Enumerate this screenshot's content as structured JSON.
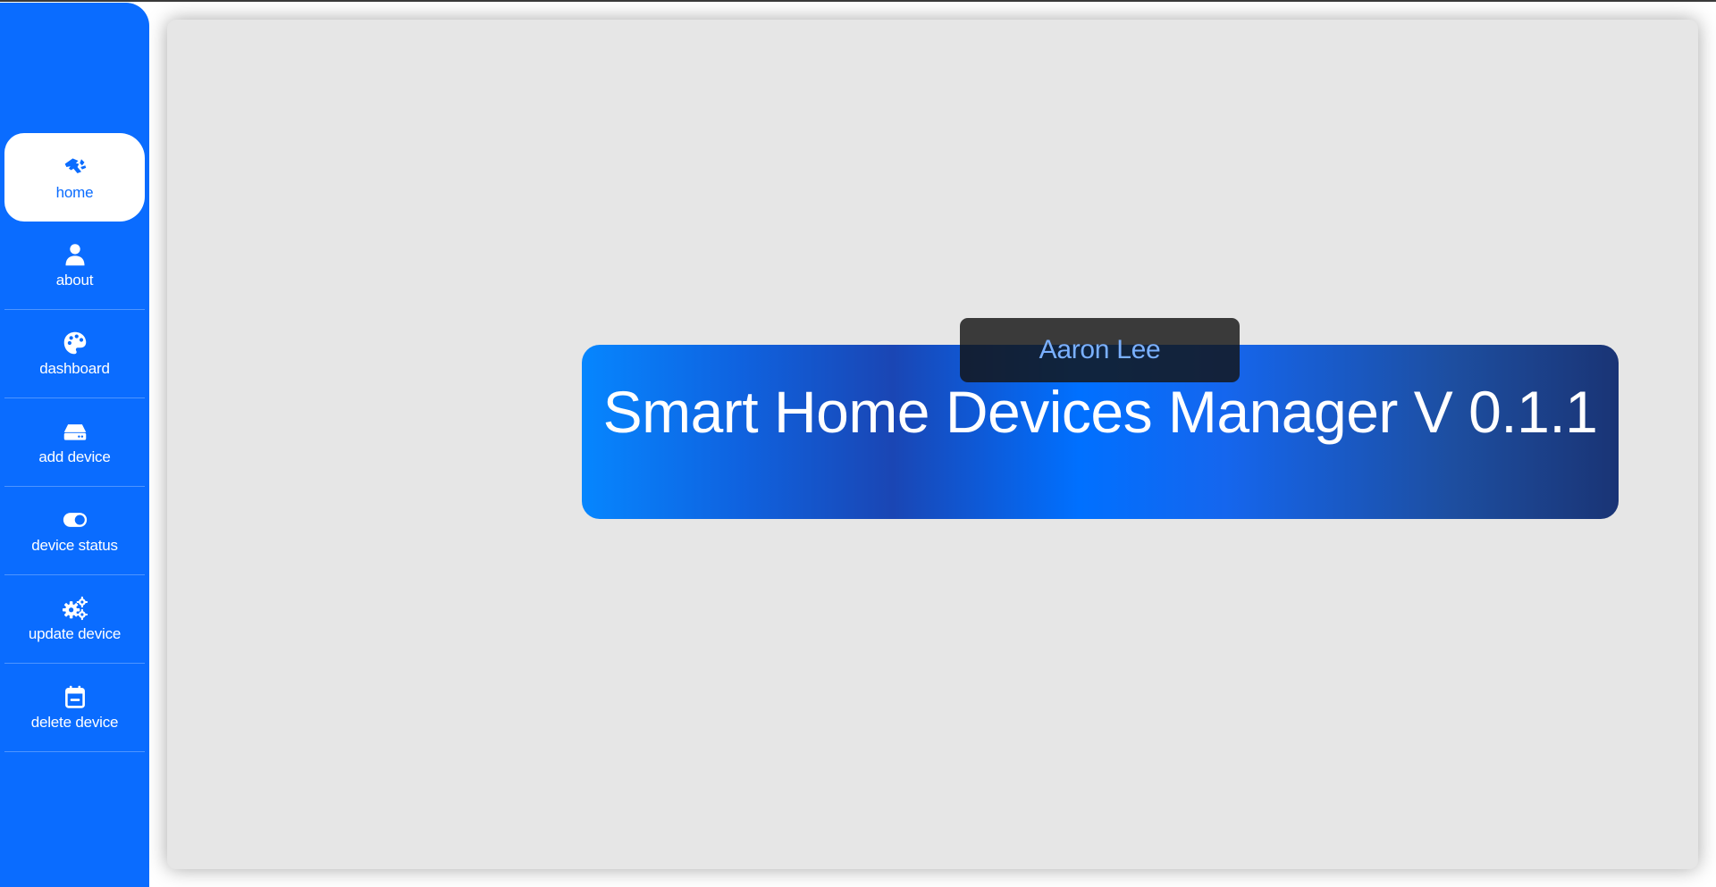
{
  "app": {
    "title": "Smart Home Devices Manager V 0.1.1",
    "author": "Aaron Lee"
  },
  "sidebar": {
    "items": [
      {
        "label": "home",
        "icon": "hand-icon",
        "active": true
      },
      {
        "label": "about",
        "icon": "user-icon",
        "active": false
      },
      {
        "label": "dashboard",
        "icon": "palette-icon",
        "active": false
      },
      {
        "label": "add device",
        "icon": "hard-drive-icon",
        "active": false
      },
      {
        "label": "device status",
        "icon": "toggle-icon",
        "active": false
      },
      {
        "label": "update device",
        "icon": "gears-icon",
        "active": false
      },
      {
        "label": "delete device",
        "icon": "calendar-minus-icon",
        "active": false
      }
    ]
  },
  "colors": {
    "primary": "#0a6cff",
    "content_background": "#e6e6e6",
    "author_text": "#7ab0ff"
  }
}
